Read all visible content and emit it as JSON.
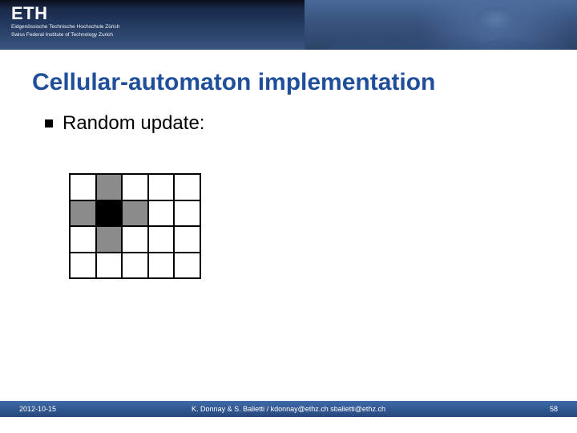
{
  "banner": {
    "logo": "ETH",
    "sub1": "Eidgenössische Technische Hochschule Zürich",
    "sub2": "Swiss Federal Institute of Technology Zurich"
  },
  "title": "Cellular-automaton implementation",
  "bullet": "Random update:",
  "grid": {
    "rows": 4,
    "cols": 5,
    "cells": [
      [
        "white",
        "gray",
        "white",
        "white",
        "white"
      ],
      [
        "gray",
        "black",
        "gray",
        "white",
        "white"
      ],
      [
        "white",
        "gray",
        "white",
        "white",
        "white"
      ],
      [
        "white",
        "white",
        "white",
        "white",
        "white"
      ]
    ]
  },
  "footer": {
    "date": "2012-10-15",
    "center": "K. Donnay & S. Balietti  /  kdonnay@ethz.ch   sbalietti@ethz.ch",
    "page": "58"
  }
}
